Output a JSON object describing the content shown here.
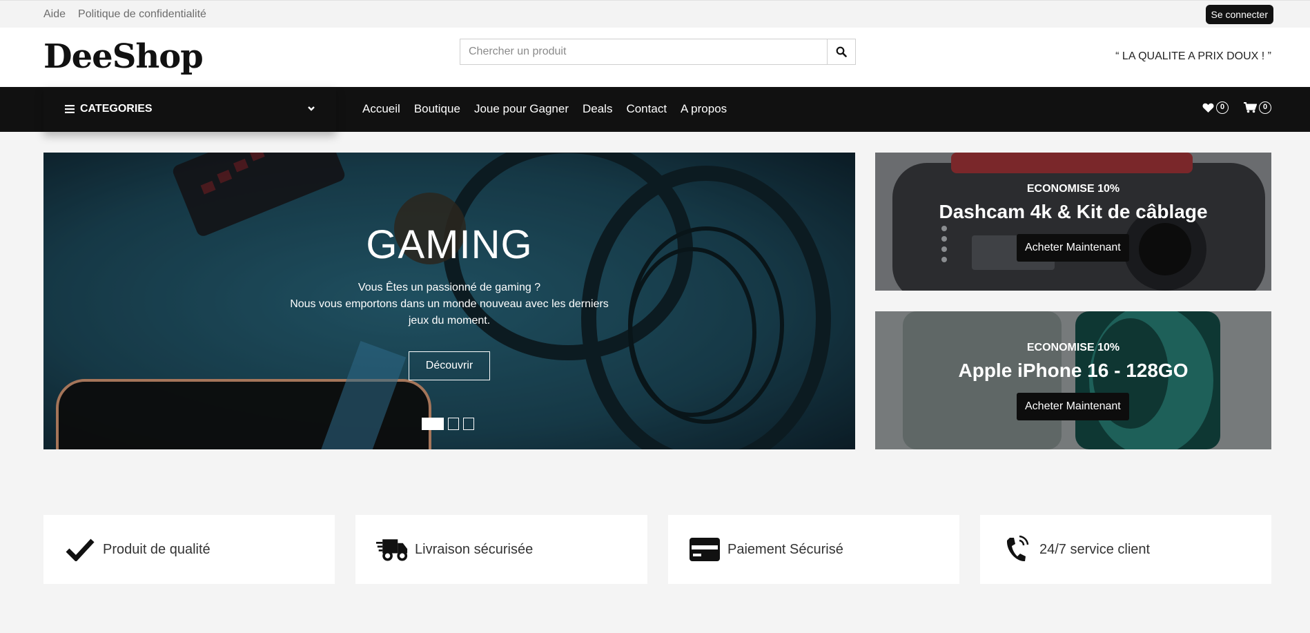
{
  "topbar": {
    "links": [
      "Aide",
      "Politique de confidentialité"
    ],
    "login_label": "Se connecter"
  },
  "header": {
    "logo": "DeeShop",
    "search_placeholder": "Chercher un produit",
    "slogan": "“ LA QUALITE A PRIX DOUX ! ”"
  },
  "nav": {
    "categories_label": "CATEGORIES",
    "menu": [
      "Accueil",
      "Boutique",
      "Joue pour Gagner",
      "Deals",
      "Contact",
      "A propos"
    ],
    "wishlist_count": "0",
    "cart_count": "0"
  },
  "hero": {
    "title": "GAMING",
    "line1": "Vous Êtes un passionné de gaming ?",
    "line2": "Nous vous emportons dans un monde nouveau avec les derniers",
    "line3": "jeux du moment.",
    "cta": "Découvrir",
    "slide_count": 3,
    "active_slide": 1
  },
  "promos": [
    {
      "kicker": "ECONOMISE 10%",
      "title": "Dashcam 4k & Kit de câblage",
      "button": "Acheter Maintenant"
    },
    {
      "kicker": "ECONOMISE 10%",
      "title": "Apple iPhone 16 - 128GO",
      "button": "Acheter Maintenant"
    }
  ],
  "features": [
    {
      "label": "Produit de qualité",
      "icon": "check-icon"
    },
    {
      "label": "Livraison sécurisée",
      "icon": "truck-icon"
    },
    {
      "label": "Paiement Sécurisé",
      "icon": "credit-card-icon"
    },
    {
      "label": "24/7 service client",
      "icon": "phone-icon"
    }
  ],
  "colors": {
    "dark": "#111111",
    "background": "#f4f4f4",
    "hero_teal": "#1f4a5c"
  }
}
